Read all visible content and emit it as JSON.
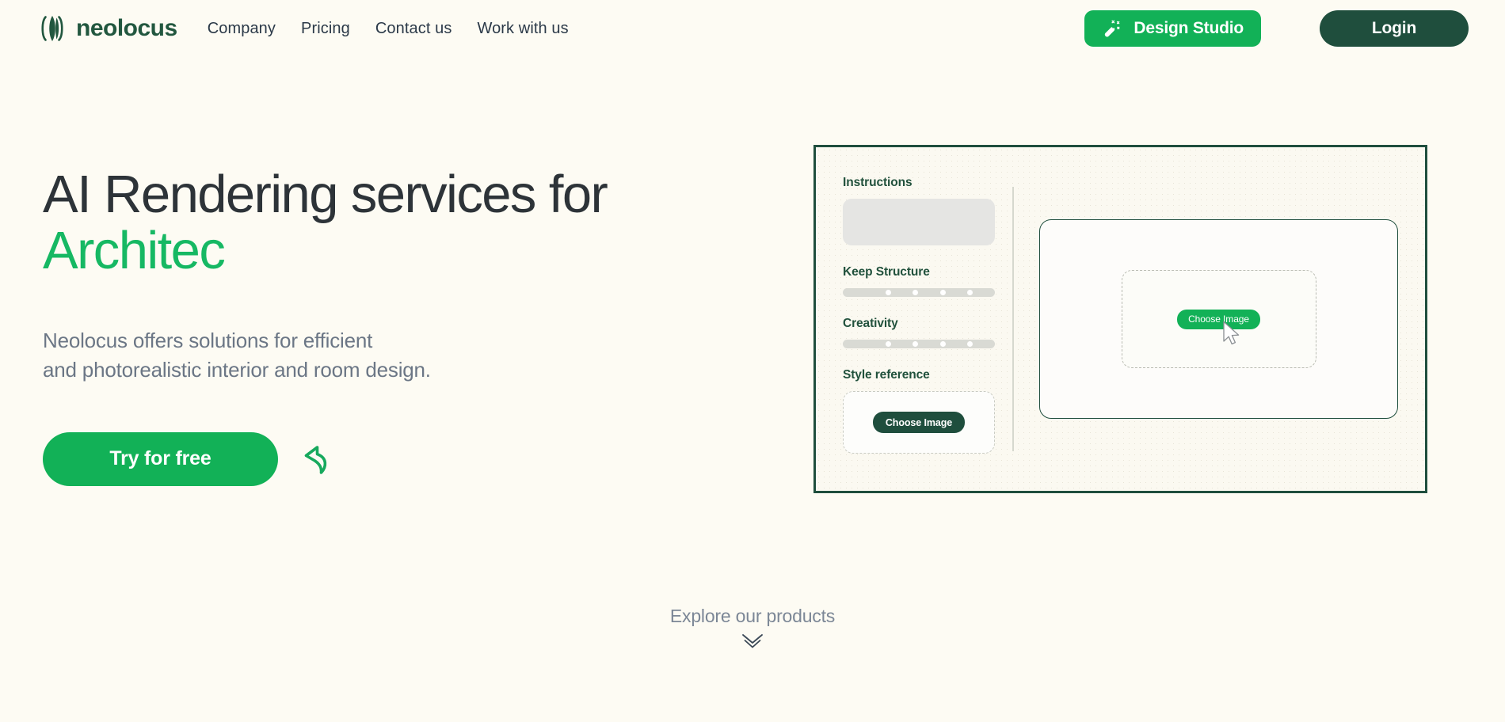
{
  "colors": {
    "background": "#fdfbf3",
    "brand_dark_green": "#1f4e3d",
    "accent_green": "#12b157",
    "heading_dark": "#2d3338",
    "muted_text": "#6b7685"
  },
  "header": {
    "brand_name": "neolocus",
    "brand_icon": "leaf-circle-logo",
    "nav": [
      {
        "label": "Company"
      },
      {
        "label": "Pricing"
      },
      {
        "label": "Contact us"
      },
      {
        "label": "Work with us"
      }
    ],
    "design_studio": {
      "label": "Design Studio",
      "icon": "magic-wand-icon"
    },
    "login": {
      "label": "Login"
    }
  },
  "hero": {
    "title_line1": "AI Rendering services for",
    "title_line2_typing": "Architec",
    "subtitle_line1": "Neolocus offers solutions for efficient",
    "subtitle_line2": "and photorealistic interior and room design.",
    "cta_label": "Try for free",
    "cta_arrow_icon": "curved-back-arrow-icon"
  },
  "mockup": {
    "sidebar": {
      "instructions_label": "Instructions",
      "instructions_value": "",
      "keep_structure_label": "Keep Structure",
      "keep_structure_knobs": 4,
      "creativity_label": "Creativity",
      "creativity_knobs": 4,
      "style_reference_label": "Style reference",
      "style_reference_button": "Choose Image"
    },
    "canvas": {
      "choose_image_button": "Choose Image",
      "cursor_icon": "mouse-pointer-icon"
    }
  },
  "explore": {
    "label": "Explore our products",
    "icon": "double-chevron-down-icon"
  }
}
